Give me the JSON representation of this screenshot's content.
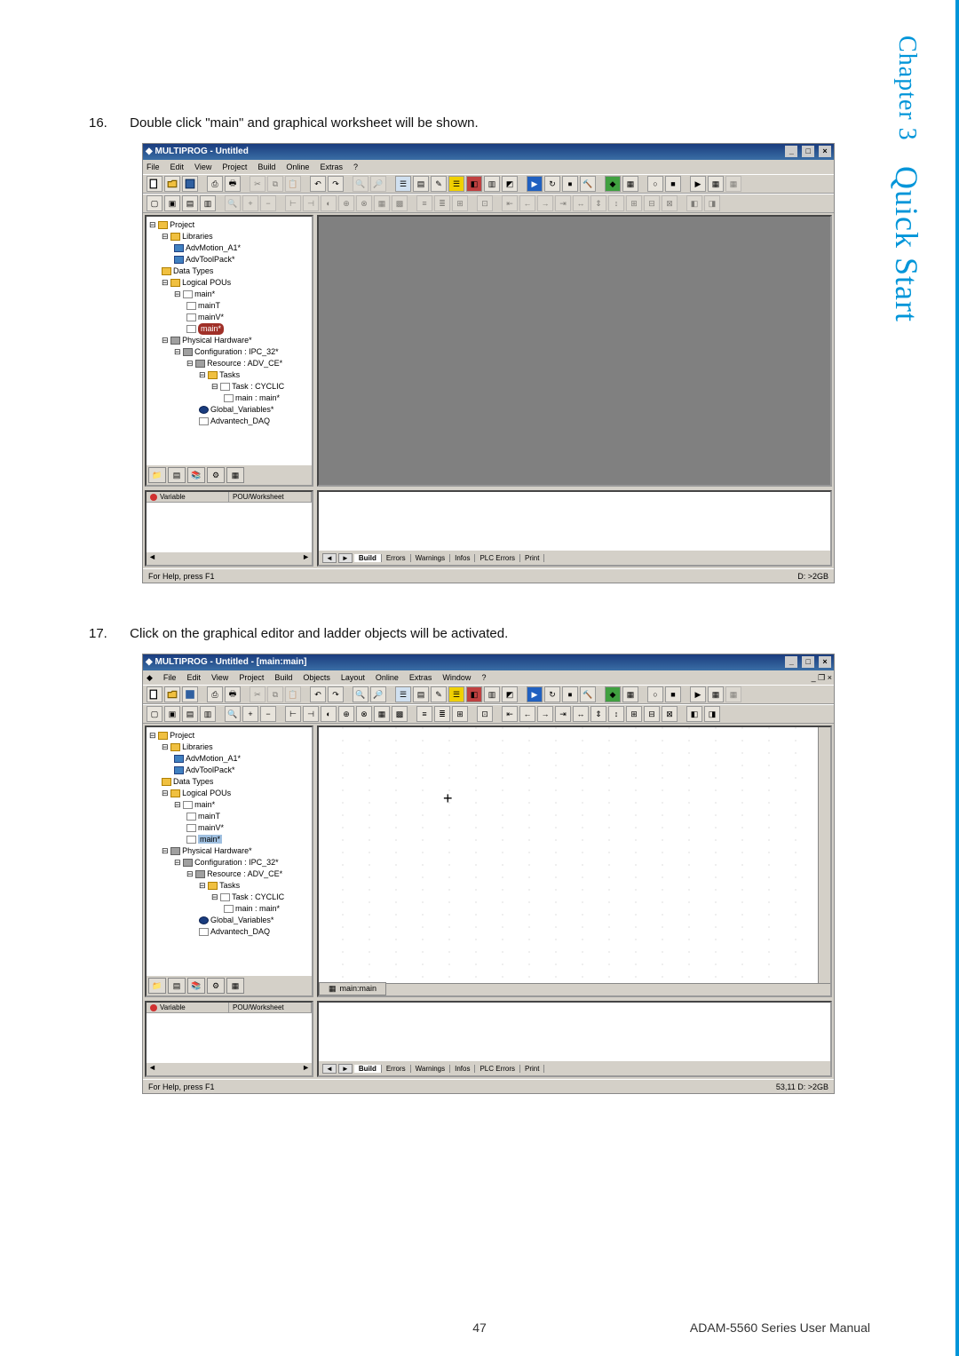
{
  "sidebar": {
    "chapter": "Chapter 3",
    "title": "Quick Start"
  },
  "instructions": {
    "step16_num": "16.",
    "step16_text": "Double click \"main\" and graphical worksheet will be shown.",
    "step17_num": "17.",
    "step17_text": "Click on the graphical editor and ladder objects will be activated."
  },
  "shot1": {
    "title": "MULTIPROG - Untitled",
    "menus": [
      "File",
      "Edit",
      "View",
      "Project",
      "Build",
      "Online",
      "Extras",
      "?"
    ],
    "tree": {
      "root": "Project",
      "libraries": "Libraries",
      "lib1": "AdvMotion_A1*",
      "lib2": "AdvToolPack*",
      "datatypes": "Data Types",
      "logical": "Logical POUs",
      "main": "main*",
      "mainT": "mainT",
      "mainV": "mainV*",
      "mainSel": "main*",
      "physical": "Physical Hardware*",
      "config": "Configuration : IPC_32*",
      "resource": "Resource : ADV_CE*",
      "tasks": "Tasks",
      "task": "Task : CYCLIC",
      "taskmain": "main : main*",
      "globals": "Global_Variables*",
      "daq": "Advantech_DAQ"
    },
    "var_header": {
      "col1": "Variable",
      "col2": "POU/Worksheet"
    },
    "msg_tabs": [
      "Build",
      "Errors",
      "Warnings",
      "Infos",
      "PLC Errors",
      "Print"
    ],
    "status_left": "For Help, press F1",
    "status_right": "D: >2GB"
  },
  "shot2": {
    "title": "MULTIPROG - Untitled - [main:main]",
    "menus": [
      "File",
      "Edit",
      "View",
      "Project",
      "Build",
      "Objects",
      "Layout",
      "Online",
      "Extras",
      "Window",
      "?"
    ],
    "work_tab": "main:main",
    "status_left": "For Help, press F1",
    "status_right": "53,11  D: >2GB"
  },
  "footer": {
    "page": "47",
    "doc": "ADAM-5560 Series User Manual"
  }
}
